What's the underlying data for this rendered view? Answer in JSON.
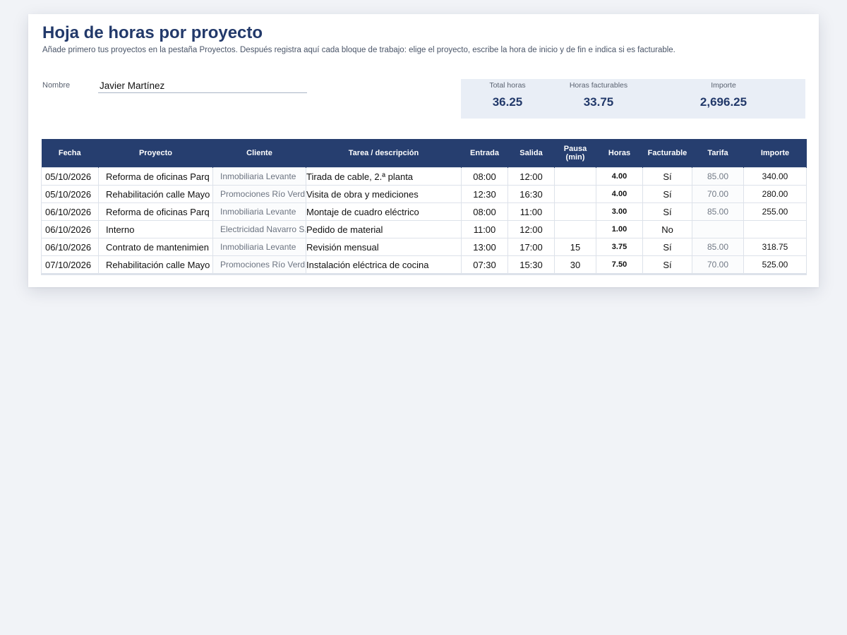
{
  "header": {
    "title": "Hoja de horas por proyecto",
    "subtitle": "Añade primero tus proyectos en la pestaña Proyectos. Después registra aquí cada bloque de trabajo: elige el proyecto, escribe la hora de inicio y de fin e indica si es facturable."
  },
  "form": {
    "name_label": "Nombre",
    "name_value": "Javier Martínez"
  },
  "summary": {
    "total_label": "Total horas",
    "total_value": "36.25",
    "billable_label": "Horas facturables",
    "billable_value": "33.75",
    "amount_label": "Importe",
    "amount_value": "2,696.25"
  },
  "table": {
    "headers": {
      "fecha": "Fecha",
      "proyecto": "Proyecto",
      "cliente": "Cliente",
      "tarea": "Tarea / descripción",
      "entrada": "Entrada",
      "salida": "Salida",
      "pausa_1": "Pausa",
      "pausa_2": "(min)",
      "horas": "Horas",
      "facturable": "Facturable",
      "tarifa": "Tarifa",
      "importe": "Importe"
    },
    "rows": [
      {
        "fecha": "05/10/2026",
        "proyecto": "Reforma de oficinas Parq",
        "cliente": "Inmobiliaria Levante",
        "tarea": "Tirada de cable, 2.ª planta",
        "entrada": "08:00",
        "salida": "12:00",
        "pausa": "",
        "horas": "4.00",
        "facturable": "Sí",
        "tarifa": "85.00",
        "importe": "340.00"
      },
      {
        "fecha": "05/10/2026",
        "proyecto": "Rehabilitación calle Mayo",
        "cliente": "Promociones Río Verd",
        "tarea": "Visita de obra y mediciones",
        "entrada": "12:30",
        "salida": "16:30",
        "pausa": "",
        "horas": "4.00",
        "facturable": "Sí",
        "tarifa": "70.00",
        "importe": "280.00"
      },
      {
        "fecha": "06/10/2026",
        "proyecto": "Reforma de oficinas Parq",
        "cliente": "Inmobiliaria Levante",
        "tarea": "Montaje de cuadro eléctrico",
        "entrada": "08:00",
        "salida": "11:00",
        "pausa": "",
        "horas": "3.00",
        "facturable": "Sí",
        "tarifa": "85.00",
        "importe": "255.00"
      },
      {
        "fecha": "06/10/2026",
        "proyecto": "Interno",
        "cliente": "Electricidad Navarro S.",
        "tarea": "Pedido de material",
        "entrada": "11:00",
        "salida": "12:00",
        "pausa": "",
        "horas": "1.00",
        "facturable": "No",
        "tarifa": "",
        "importe": ""
      },
      {
        "fecha": "06/10/2026",
        "proyecto": "Contrato de mantenimien",
        "cliente": "Inmobiliaria Levante",
        "tarea": "Revisión mensual",
        "entrada": "13:00",
        "salida": "17:00",
        "pausa": "15",
        "horas": "3.75",
        "facturable": "Sí",
        "tarifa": "85.00",
        "importe": "318.75"
      },
      {
        "fecha": "07/10/2026",
        "proyecto": "Rehabilitación calle Mayo",
        "cliente": "Promociones Río Verd",
        "tarea": "Instalación eléctrica de cocina",
        "entrada": "07:30",
        "salida": "15:30",
        "pausa": "30",
        "horas": "7.50",
        "facturable": "Sí",
        "tarifa": "70.00",
        "importe": "525.00"
      }
    ]
  }
}
